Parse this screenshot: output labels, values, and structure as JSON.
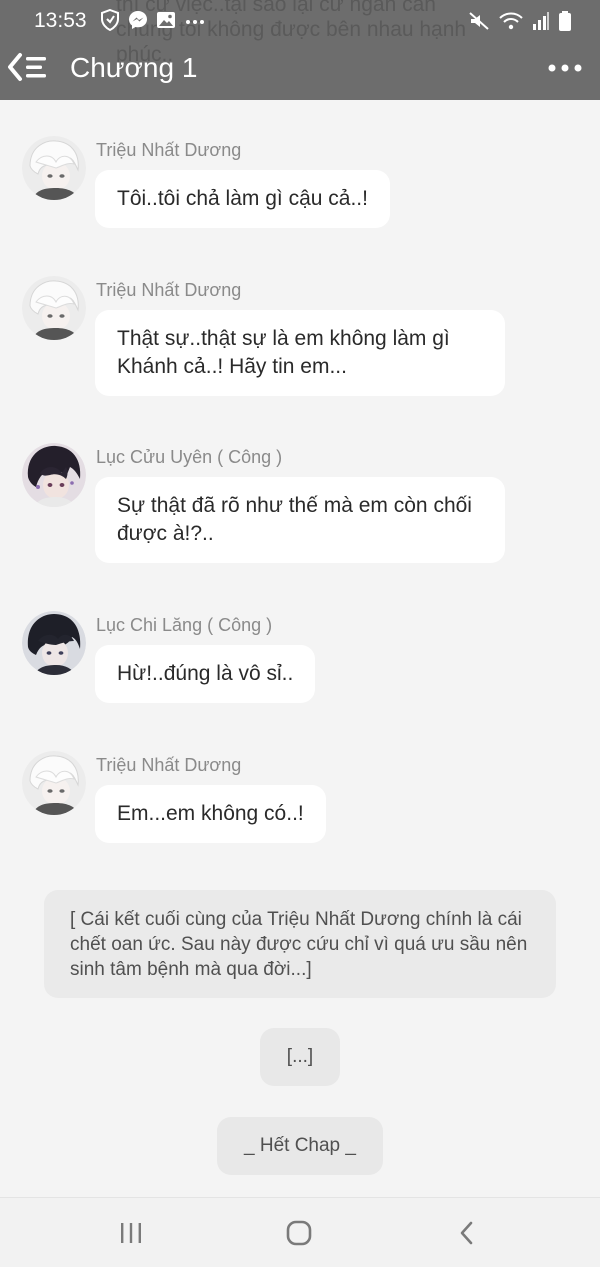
{
  "status_bar": {
    "time": "13:53",
    "icons_left": [
      "shield-icon",
      "messenger-icon",
      "image-icon",
      "more-dots-icon"
    ],
    "icons_right": [
      "mute-icon",
      "wifi-icon",
      "signal-icon",
      "battery-icon"
    ]
  },
  "header": {
    "title": "Chương 1",
    "ghost_text": "thì cứ việc..tại sao lại cứ ngăn cản chúng tôi không được bên nhau hạnh phúc.."
  },
  "messages": [
    {
      "sender": "Triệu Nhất Dương",
      "text": "Tôi..tôi chả làm gì cậu cả..!",
      "avatar": "white-hair"
    },
    {
      "sender": "Triệu Nhất Dương",
      "text": "Thật sự..thật sự là em không làm gì Khánh cả..! Hãy tin em...",
      "avatar": "white-hair"
    },
    {
      "sender": "Lục Cửu Uyên ( Công )",
      "text": "Sự thật đã rõ như thế mà em còn chối được à!?..",
      "avatar": "dark-hair-pierced"
    },
    {
      "sender": "Lục Chi Lăng ( Công )",
      "text": "Hừ!..đúng là vô sỉ..",
      "avatar": "dark-hair"
    },
    {
      "sender": "Triệu Nhất Dương",
      "text": "Em...em không có..!",
      "avatar": "white-hair"
    }
  ],
  "narration": "[ Cái kết cuối cùng của Triệu Nhất Dương chính là cái chết oan ức. Sau này được cứu chỉ vì quá ưu sầu nên sinh tâm bệnh mà qua đời...]",
  "ellipsis_label": "[...]",
  "end_label": "_ Hết Chap _",
  "colors": {
    "header_bg": "#6d6d6d",
    "page_bg": "#f4f4f4",
    "bubble_bg": "#ffffff",
    "sender_text": "#8a8a8a"
  }
}
